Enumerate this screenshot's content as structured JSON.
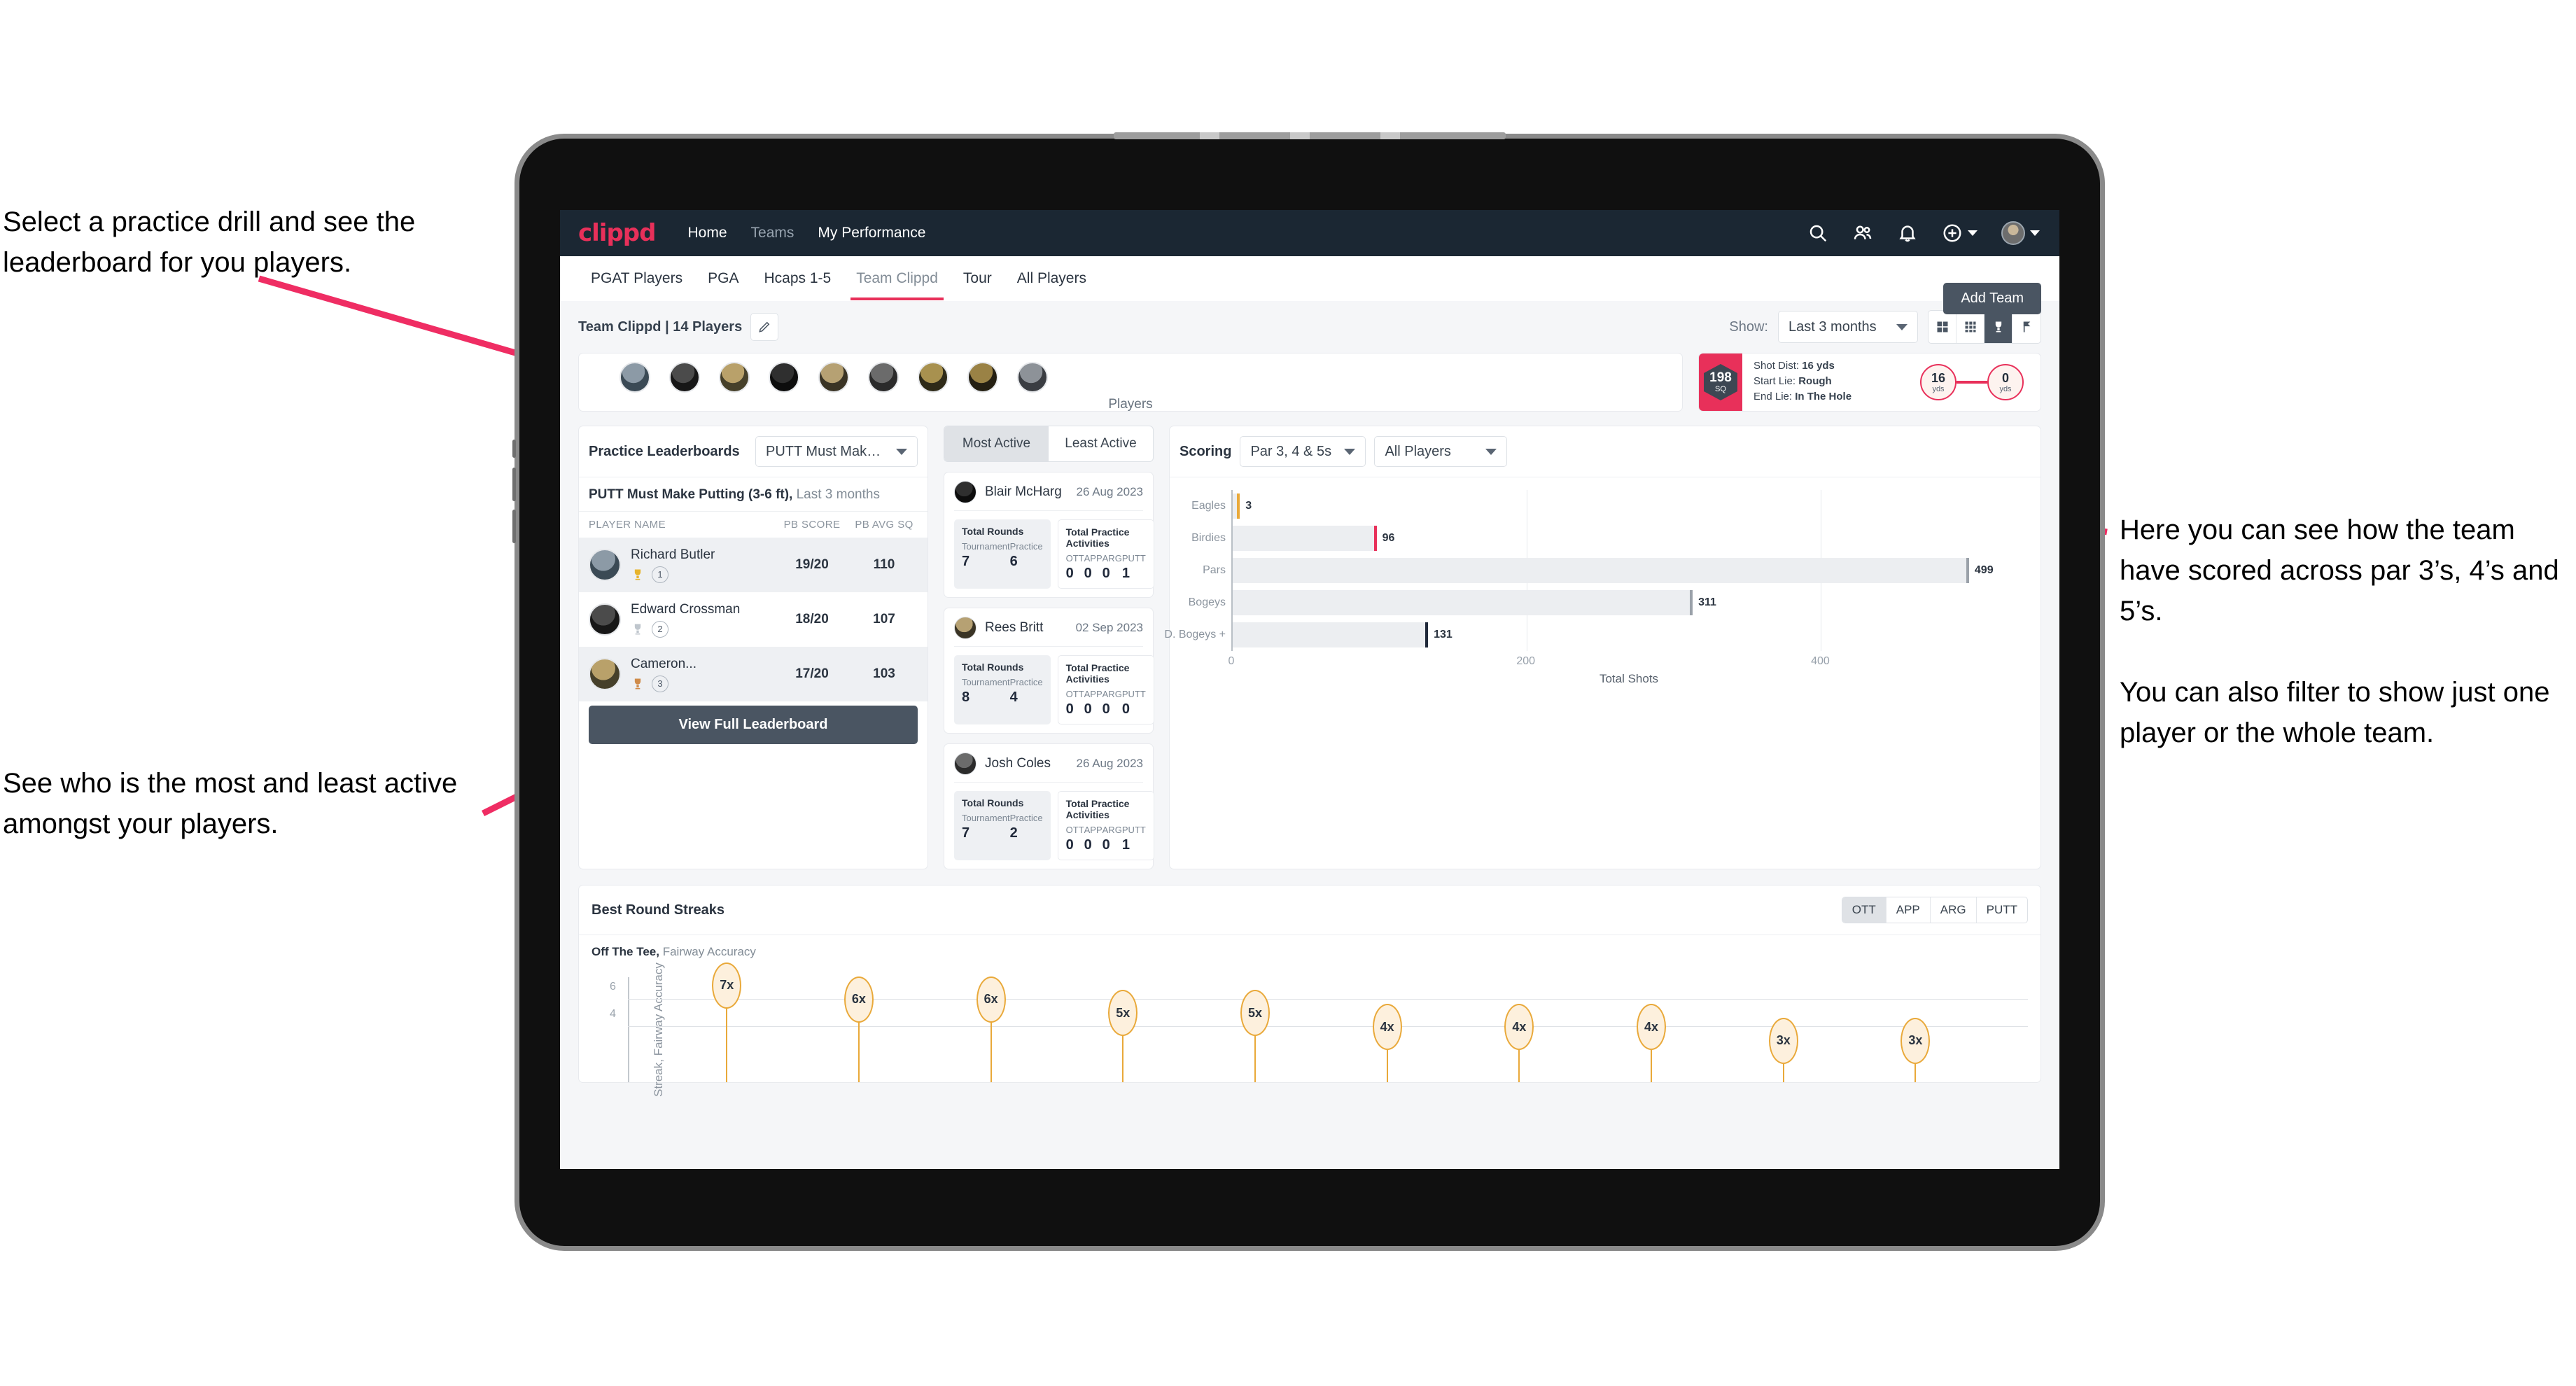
{
  "annotations": {
    "top_left": "Select a practice drill and see the leaderboard for you players.",
    "bottom_left": "See who is the most and least active amongst your players.",
    "right": "Here you can see how the team have scored across par 3’s, 4’s and 5’s.\n\nYou can also filter to show just one player or the whole team."
  },
  "colors": {
    "accent_pink": "#e8305a",
    "navbar": "#1b2733",
    "button_slate": "#4a5562",
    "streak_orange": "#e9a93a"
  },
  "navbar": {
    "logo": "clippd",
    "links": [
      {
        "label": "Home",
        "active": true
      },
      {
        "label": "Teams",
        "active": false
      },
      {
        "label": "My Performance",
        "active": true
      }
    ],
    "icons": [
      "search-icon",
      "people-icon",
      "bell-icon",
      "plus-circle-icon",
      "avatar"
    ]
  },
  "tabs": {
    "items": [
      "PGAT Players",
      "PGA",
      "Hcaps 1-5",
      "Team Clippd",
      "Tour",
      "All Players"
    ],
    "active": "Team Clippd",
    "add_team_label": "Add Team"
  },
  "teambar": {
    "title": "Team Clippd | 14 Players",
    "edit_icon": "pencil-icon",
    "show_label": "Show:",
    "show_value": "Last 3 months",
    "view_modes": [
      "grid-large-icon",
      "grid-small-icon",
      "trophy-icon",
      "flag-icon"
    ],
    "active_view_mode": "trophy-icon"
  },
  "players_card": {
    "caption": "Players",
    "avatar_count": 9
  },
  "shot_card": {
    "sq_value": "198",
    "sq_unit": "SQ",
    "lines": [
      {
        "label": "Shot Dist:",
        "value": "16 yds"
      },
      {
        "label": "Start Lie:",
        "value": "Rough"
      },
      {
        "label": "End Lie:",
        "value": "In The Hole"
      }
    ],
    "start_yards": "16",
    "start_unit": "yds",
    "end_yards": "0",
    "end_unit": "yds"
  },
  "leaderboard": {
    "title": "Practice Leaderboards",
    "drill_select": "PUTT Must Make Putting ...",
    "subtitle_bold": "PUTT Must Make Putting (3-6 ft),",
    "subtitle_rest": " Last 3 months",
    "columns": [
      "PLAYER NAME",
      "PB SCORE",
      "PB AVG SQ"
    ],
    "rows": [
      {
        "name": "Richard Butler",
        "rank": "1",
        "trophy": "gold",
        "score": "19/20",
        "avg": "110"
      },
      {
        "name": "Edward Crossman",
        "rank": "2",
        "trophy": "silver",
        "score": "18/20",
        "avg": "107"
      },
      {
        "name": "Cameron...",
        "rank": "3",
        "trophy": "bronze",
        "score": "17/20",
        "avg": "103"
      }
    ],
    "button": "View Full Leaderboard"
  },
  "activity": {
    "tabs": [
      {
        "label": "Most Active",
        "active": true
      },
      {
        "label": "Least Active",
        "active": false
      }
    ],
    "rounds_title": "Total Rounds",
    "acts_title": "Total Practice Activities",
    "rounds_keys": [
      "Tournament",
      "Practice"
    ],
    "acts_keys": [
      "OTT",
      "APP",
      "ARG",
      "PUTT"
    ],
    "players": [
      {
        "name": "Blair McHarg",
        "date": "26 Aug 2023",
        "tournament": "7",
        "practice": "6",
        "ott": "0",
        "app": "0",
        "arg": "0",
        "putt": "1"
      },
      {
        "name": "Rees Britt",
        "date": "02 Sep 2023",
        "tournament": "8",
        "practice": "4",
        "ott": "0",
        "app": "0",
        "arg": "0",
        "putt": "0"
      },
      {
        "name": "Josh Coles",
        "date": "26 Aug 2023",
        "tournament": "7",
        "practice": "2",
        "ott": "0",
        "app": "0",
        "arg": "0",
        "putt": "1"
      }
    ]
  },
  "scoring": {
    "title": "Scoring",
    "par_select": "Par 3, 4 & 5s",
    "player_select": "All Players"
  },
  "streaks": {
    "title": "Best Round Streaks",
    "segments": [
      "OTT",
      "APP",
      "ARG",
      "PUTT"
    ],
    "active_segment": "OTT",
    "subtitle_bold": "Off The Tee,",
    "subtitle_rest": " Fairway Accuracy"
  },
  "chart_data": [
    {
      "type": "bar",
      "orientation": "horizontal",
      "title": "Scoring",
      "categories": [
        "Eagles",
        "Birdies",
        "Pars",
        "Bogeys",
        "D. Bogeys +"
      ],
      "values": [
        3,
        96,
        499,
        311,
        131
      ],
      "bar_cap_colors": [
        "#e9a93a",
        "#e8305a",
        "#9aa1a9",
        "#9aa1a9",
        "#20293a"
      ],
      "xlabel": "Total Shots",
      "ylabel": "",
      "xlim": [
        0,
        540
      ],
      "xticks": [
        0,
        200,
        400
      ],
      "grid": true,
      "legend": false
    },
    {
      "type": "scatter",
      "subtype": "lollipop",
      "title": "Best Round Streaks",
      "series_name": "Off The Tee, Fairway Accuracy",
      "ylabel": "Streak, Fairway Accuracy",
      "ylim": [
        0,
        7.6
      ],
      "yticks": [
        4,
        6
      ],
      "point_labels": [
        "7x",
        "6x",
        "6x",
        "5x",
        "5x",
        "4x",
        "4x",
        "4x",
        "3x",
        "3x"
      ],
      "values": [
        7,
        6,
        6,
        5,
        5,
        4,
        4,
        4,
        3,
        3
      ],
      "grid": true,
      "legend": false
    }
  ]
}
